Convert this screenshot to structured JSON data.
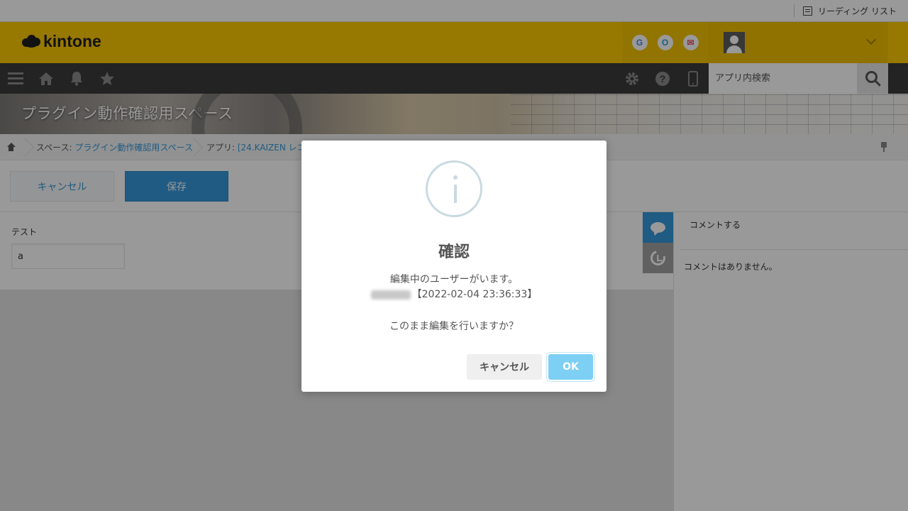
{
  "browser": {
    "reading_list_label": "リーディング リスト"
  },
  "header": {
    "logo_text": "kintone",
    "app_icons": [
      "G",
      "O",
      "✉"
    ]
  },
  "toolbar": {
    "search_placeholder": "アプリ内検索"
  },
  "space": {
    "title": "プラグイン動作確認用スペース"
  },
  "breadcrumb": {
    "space_prefix": "スペース: ",
    "space_link": "プラグイン動作確認用スペース",
    "app_prefix": "アプリ: ",
    "app_link": "[24.KAIZEN レコ"
  },
  "actions": {
    "cancel_label": "キャンセル",
    "save_label": "保存"
  },
  "form": {
    "field_label": "テスト",
    "field_value": "a"
  },
  "comments": {
    "input_placeholder": "コメントする",
    "empty_message": "コメントはありません。"
  },
  "dialog": {
    "title": "確認",
    "message_line1": "編集中のユーザーがいます。",
    "timestamp": "【2022-02-04 23:36:33】",
    "question": "このまま編集を行いますか？",
    "cancel_label": "キャンセル",
    "ok_label": "OK"
  },
  "colors": {
    "header_yellow": "#fcc800",
    "toolbar_dark": "#3b3b3b",
    "accent_blue": "#3498db",
    "ok_blue": "#7ecff4"
  }
}
